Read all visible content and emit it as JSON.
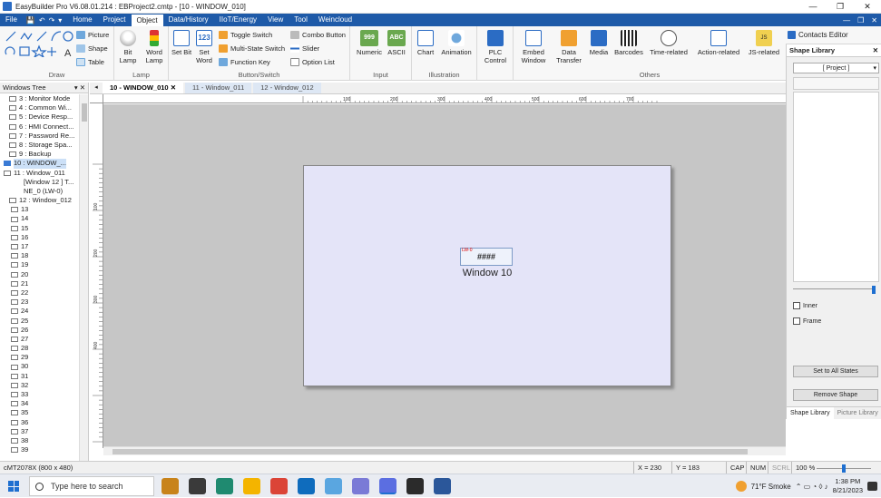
{
  "titlebar": {
    "title": "EasyBuilder Pro V6.08.01.214 : EBProject2.cmtp - [10 - WINDOW_010]",
    "minimize": "—",
    "restore": "❐",
    "close": "✕"
  },
  "menubar": {
    "items": [
      "File",
      "Home",
      "Project",
      "Object",
      "Data/History",
      "IIoT/Energy",
      "View",
      "Tool",
      "Weincloud"
    ],
    "active_index": 3,
    "quick_access": [
      "💾",
      "↶",
      "↷",
      "▾"
    ],
    "right_controls": [
      "—",
      "❐",
      "✕"
    ]
  },
  "ribbon": {
    "groups": {
      "draw": "Draw",
      "lamp": "Lamp",
      "button_switch": "Button/Switch",
      "input": "Input",
      "illustration": "Illustration",
      "others": "Others"
    },
    "draw_small": [
      "Picture",
      "Shape",
      "Table"
    ],
    "lamp": [
      "Bit Lamp",
      "Word Lamp"
    ],
    "setbit": [
      "Set Bit",
      "Set Word"
    ],
    "switch_col1": [
      "Toggle Switch",
      "Multi-State Switch",
      "Function Key"
    ],
    "switch_col2": [
      "Combo Button",
      "Slider",
      "Option List"
    ],
    "input": [
      "Numeric",
      "ASCII"
    ],
    "illustration": [
      "Chart",
      "Animation"
    ],
    "plc": "PLC Control",
    "others": [
      "Embed Window",
      "Data Transfer",
      "Media",
      "Barcodes",
      "Time-related",
      "Action-related",
      "JS-related"
    ]
  },
  "contacts_editor": "Contacts Editor",
  "shape_library": {
    "title": "Shape Library",
    "combo_value": "[ Project ]",
    "inner": "Inner",
    "frame": "Frame",
    "set_all_states": "Set to All States",
    "remove_shape": "Remove Shape",
    "tab_shape": "Shape Library",
    "tab_picture": "Picture Library"
  },
  "windows_tree": {
    "title": "Windows Tree",
    "rows": [
      "3 : Monitor Mode",
      "4 : Common Wi...",
      "5 : Device Resp...",
      "6 : HMI Connect...",
      "7 : Password Re...",
      "8 : Storage Spa...",
      "9 : Backup",
      "10 : WINDOW_...",
      "11 : Window_011",
      "[Window 12 ] T...",
      "NE_0 (LW-0)",
      "12 : Window_012",
      "13",
      "14",
      "15",
      "16",
      "17",
      "18",
      "19",
      "20",
      "21",
      "22",
      "23",
      "24",
      "25",
      "26",
      "27",
      "28",
      "29",
      "30",
      "31",
      "32",
      "33",
      "34",
      "35",
      "36",
      "37",
      "38",
      "39"
    ],
    "selected_index": 7
  },
  "doc_tabs": [
    "10 - WINDOW_010",
    "11 - Window_011",
    "12 - Window_012"
  ],
  "ruler_h_labels": [
    "100",
    "200",
    "300",
    "400",
    "500",
    "600",
    "700"
  ],
  "ruler_v_labels": [
    "100",
    "200",
    "300",
    "400"
  ],
  "canvas": {
    "numeric_tag": "LW-0",
    "numeric_value": "####",
    "window_label": "Window 10"
  },
  "statusbar": {
    "model": "cMT2078X (800 x 480)",
    "x": "X = 230",
    "y": "Y = 183",
    "cap": "CAP",
    "num": "NUM",
    "scrl": "SCRL",
    "zoom": "100 %"
  },
  "taskbar": {
    "search_placeholder": "Type here to search",
    "weather": "71°F  Smoke",
    "time": "1:38 PM",
    "date": "8/21/2023",
    "app_colors": [
      "#c8831a",
      "#3a3a3a",
      "#1f8a70",
      "#f4b400",
      "#db4437",
      "#0f6cbd",
      "#5aa6e0",
      "#7a7ad6",
      "#5b6ee1",
      "#2b2b2b",
      "#2b579a"
    ]
  },
  "colors": {
    "menubar": "#1e5aa8",
    "canvas_bg": "#c6c6c6",
    "window_bg": "#e4e4f8"
  }
}
